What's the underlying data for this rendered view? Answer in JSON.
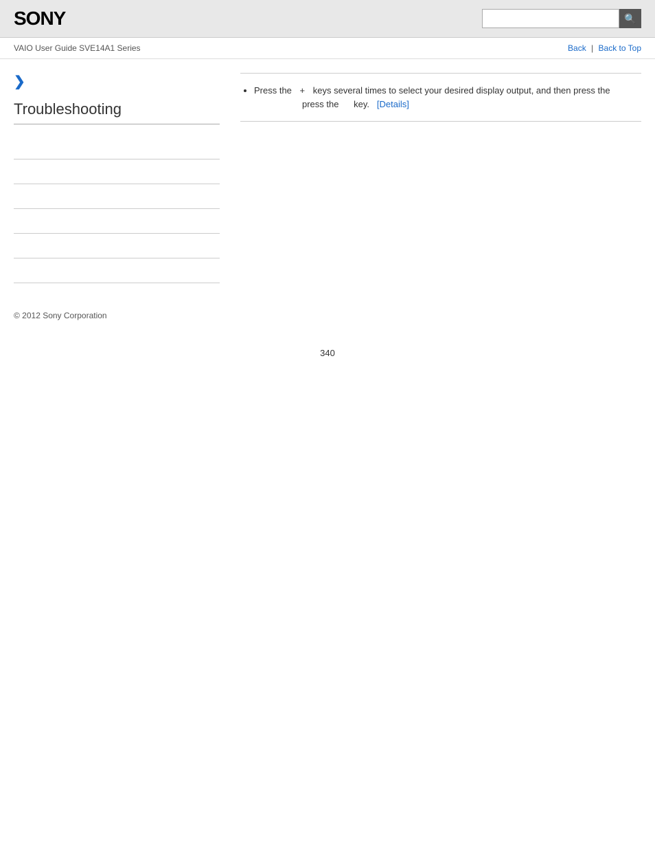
{
  "header": {
    "logo": "SONY",
    "search_placeholder": "",
    "search_icon": "🔍"
  },
  "breadcrumb": {
    "left": "VAIO User Guide SVE14A1 Series",
    "back_label": "Back",
    "separator": "|",
    "back_to_top_label": "Back to Top"
  },
  "sidebar": {
    "chevron": "❯",
    "section_title": "Troubleshooting",
    "nav_items": [
      {
        "label": "",
        "href": "#"
      },
      {
        "label": "",
        "href": "#"
      },
      {
        "label": "",
        "href": "#"
      },
      {
        "label": "",
        "href": "#"
      },
      {
        "label": "",
        "href": "#"
      },
      {
        "label": "",
        "href": "#"
      }
    ]
  },
  "content": {
    "bullet_items": [
      {
        "prefix": "Press the",
        "plus": "+",
        "middle": "keys several times to select your desired display output, and then press the",
        "suffix": "key.",
        "details_label": "[Details]",
        "details_href": "#"
      }
    ]
  },
  "footer": {
    "copyright": "© 2012 Sony Corporation"
  },
  "page_number": "340"
}
